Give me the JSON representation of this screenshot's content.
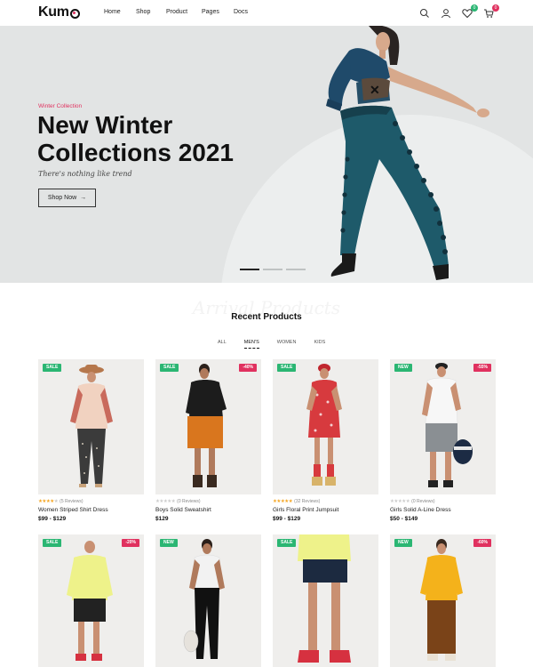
{
  "brand": {
    "name_prefix": "Kum",
    "accent": "#e0315f"
  },
  "nav": [
    "Home",
    "Shop",
    "Product",
    "Pages",
    "Docs"
  ],
  "header_icons": [
    {
      "name": "search-icon"
    },
    {
      "name": "user-icon"
    },
    {
      "name": "heart-icon",
      "badge": "0",
      "badge_color": "#2bb673"
    },
    {
      "name": "cart-icon",
      "badge": "0",
      "badge_color": "#e0315f"
    }
  ],
  "hero": {
    "subtitle": "Winter Collection",
    "title": "New Winter Collections 2021",
    "tagline": "There's nothing like trend",
    "button": "Shop Now",
    "slides": 3,
    "active_slide": 1
  },
  "section": {
    "ghost_text": "Arrival Products",
    "title": "Recent Products",
    "tabs": [
      "ALL",
      "MEN'S",
      "WOMEN",
      "KIDS"
    ],
    "active_tab": "MEN'S"
  },
  "products": [
    {
      "tag": "SALE",
      "tag_color": "#2bb673",
      "discount": "",
      "stars": 4,
      "reviews": "(5 Reviews)",
      "name": "Women Striped Shirt Dress",
      "price": "$99 - $129"
    },
    {
      "tag": "SALE",
      "tag_color": "#2bb673",
      "discount": "-40%",
      "stars": 0,
      "reviews": "(0 Reviews)",
      "name": "Boys Solid Sweatshirt",
      "price": "$129"
    },
    {
      "tag": "SALE",
      "tag_color": "#2bb673",
      "discount": "",
      "stars": 5,
      "reviews": "(32 Reviews)",
      "name": "Girls Floral Print Jumpsuit",
      "price": "$99 - $129"
    },
    {
      "tag": "NEW",
      "tag_color": "#2bb673",
      "discount": "-55%",
      "stars": 0,
      "reviews": "(0 Reviews)",
      "name": "Girls Solid A-Line Dress",
      "price": "$50 - $149"
    },
    {
      "tag": "SALE",
      "tag_color": "#2bb673",
      "discount": "-20%",
      "stars": null,
      "reviews": "",
      "name": "",
      "price": ""
    },
    {
      "tag": "NEW",
      "tag_color": "#2bb673",
      "discount": "",
      "stars": null,
      "reviews": "",
      "name": "",
      "price": ""
    },
    {
      "tag": "SALE",
      "tag_color": "#2bb673",
      "discount": "",
      "stars": null,
      "reviews": "",
      "name": "",
      "price": ""
    },
    {
      "tag": "NEW",
      "tag_color": "#2bb673",
      "discount": "-60%",
      "stars": null,
      "reviews": "",
      "name": "",
      "price": ""
    }
  ]
}
